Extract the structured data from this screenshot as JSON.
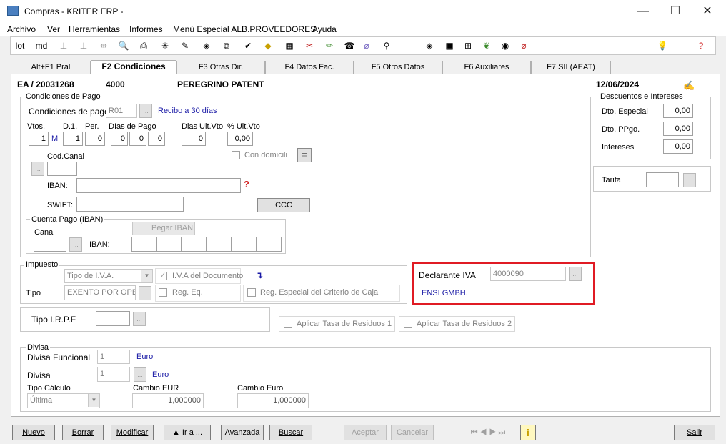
{
  "window": {
    "title": "Compras - KRITER ERP -",
    "minimize": "—",
    "maximize": "☐",
    "close": "✕"
  },
  "menu": [
    "Archivo",
    "Ver",
    "Herramientas",
    "Informes",
    "Menú Especial ALB.PROVEEDORES",
    "Ayuda"
  ],
  "toolbar": {
    "lot": "lot",
    "md": "md"
  },
  "tabs": [
    "Alt+F1 Pral",
    "F2 Condiciones",
    "F3 Otras Dir.",
    "F4 Datos Fac.",
    "F5 Otros Datos",
    "F6 Auxiliares",
    "F7 SII (AEAT)"
  ],
  "header": {
    "doc": "EA / 20031268",
    "code": "4000",
    "name": "PEREGRINO PATENT",
    "date": "12/06/2024"
  },
  "pago": {
    "legend": "Condiciones de Pago",
    "cond_label": "Condiciones de pago",
    "cond_value": "R01",
    "cond_desc": "Recibo a 30 días",
    "vtos_label": "Vtos.",
    "vtos": "1",
    "m": "M",
    "d1_label": "D.1.",
    "d1": "1",
    "per_label": "Per.",
    "per": "0",
    "dias_label": "Días de Pago",
    "dias": [
      "0",
      "0",
      "0"
    ],
    "dias_ult_label": "Dias Ult.Vto",
    "dias_ult": "0",
    "pct_ult_label": "% Ult.Vto",
    "pct_ult": "0,00",
    "domicili": "Con domicili",
    "cod_canal": "Cod.Canal",
    "iban_label": "IBAN:",
    "swift_label": "SWIFT:",
    "ccc": "CCC"
  },
  "cuenta": {
    "legend": "Cuenta Pago (IBAN)",
    "canal": "Canal",
    "pegar": "Pegar IBAN",
    "iban_label": "IBAN:"
  },
  "descuentos": {
    "legend": "Descuentos e Intereses",
    "esp_label": "Dto. Especial",
    "esp": "0,00",
    "ppgo_label": "Dto. PPgo.",
    "ppgo": "0,00",
    "int_label": "Intereses",
    "int": "0,00"
  },
  "tarifa": {
    "label": "Tarifa"
  },
  "impuesto": {
    "legend": "Impuesto",
    "tipo_label": "Tipo",
    "tipo_iva": "Tipo de I.V.A.",
    "tipo_value": "EXENTO POR OPE",
    "iva_doc": "I.V.A del Documento",
    "reg_eq": "Reg. Eq.",
    "reg_esp": "Reg. Especial del Criterio de Caja",
    "declarante_label": "Declarante IVA",
    "declarante": "4000090",
    "declarante_name": "ENSI GMBH."
  },
  "irpf": {
    "label": "Tipo I.R.P.F",
    "tasa1": "Aplicar Tasa de Residuos 1",
    "tasa2": "Aplicar Tasa de Residuos 2"
  },
  "divisa": {
    "legend": "Divisa",
    "func_label": "Divisa Funcional",
    "func_value": "1",
    "func_name": "Euro",
    "div_label": "Divisa",
    "div_value": "1",
    "div_name": "Euro",
    "calc_label": "Tipo Cálculo",
    "calc_value": "Última",
    "eur_label": "Cambio EUR",
    "eur": "1,000000",
    "euro_label": "Cambio Euro",
    "euro": "1,000000"
  },
  "buttons": {
    "nuevo": "Nuevo",
    "borrar": "Borrar",
    "modificar": "Modificar",
    "ira": "▲ Ir a ...",
    "avanzada": "Avanzada",
    "buscar": "Buscar",
    "aceptar": "Aceptar",
    "cancelar": "Cancelar",
    "salir": "Salir",
    "nav": "⏮ ◀ ▶ ⏭",
    "info": "i",
    "dots": "..."
  }
}
